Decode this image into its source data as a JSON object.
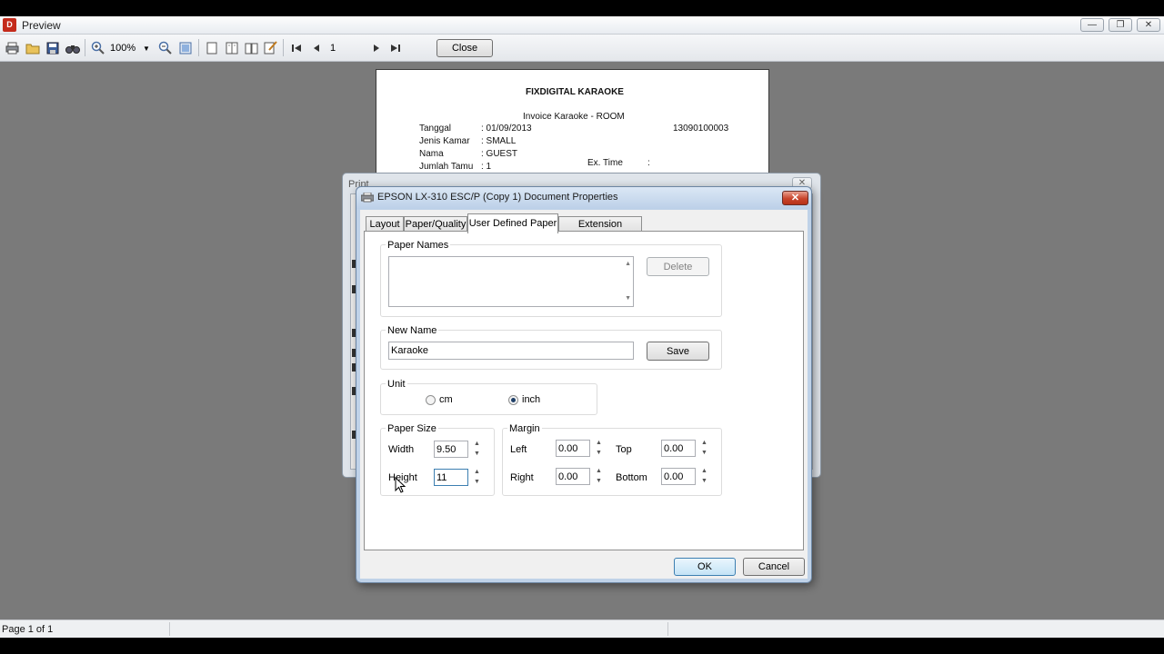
{
  "window": {
    "title": "Preview",
    "app_icon_glyph": "D"
  },
  "toolbar": {
    "zoom": "100%",
    "page_number": "1",
    "close_label": "Close",
    "icons": [
      "printer-icon",
      "open-icon",
      "save-icon",
      "find-icon",
      "zoom-in-icon",
      "zoom-out-icon",
      "fit-page-icon",
      "single-page-icon",
      "two-page-icon",
      "book-icon",
      "edit-icon",
      "first-page-icon",
      "prev-page-icon",
      "next-page-icon",
      "last-page-icon"
    ]
  },
  "report": {
    "title": "FIXDIGITAL KARAOKE",
    "subtitle": "Invoice Karaoke - ROOM",
    "invoice_no": "13090100003",
    "rows": [
      {
        "label": "Tanggal",
        "value": ": 01/09/2013"
      },
      {
        "label": "Jenis Kamar",
        "value": ": SMALL"
      },
      {
        "label": "Nama",
        "value": ": GUEST"
      },
      {
        "label": "Jumlah Tamu",
        "value": ": 1"
      }
    ],
    "ex_time_label": "Ex. Time",
    "ex_time_value": ":"
  },
  "print_dialog": {
    "title": "Print"
  },
  "props_dialog": {
    "title": "EPSON LX-310 ESC/P (Copy 1) Document Properties",
    "tabs": [
      {
        "label": "Layout"
      },
      {
        "label": "Paper/Quality"
      },
      {
        "label": "User Defined Paper"
      },
      {
        "label": "Extension Settings"
      }
    ],
    "active_tab": "User Defined Paper",
    "paper_names": {
      "label": "Paper Names",
      "delete_label": "Delete"
    },
    "new_name": {
      "label": "New Name",
      "value": "Karaoke",
      "save_label": "Save"
    },
    "unit": {
      "label": "Unit",
      "cm_label": "cm",
      "inch_label": "inch",
      "selected": "inch"
    },
    "paper_size": {
      "label": "Paper Size",
      "width_label": "Width",
      "width_value": "9.50",
      "height_label": "Height",
      "height_value": "11"
    },
    "margin": {
      "label": "Margin",
      "left_label": "Left",
      "left_value": "0.00",
      "top_label": "Top",
      "top_value": "0.00",
      "right_label": "Right",
      "right_value": "0.00",
      "bottom_label": "Bottom",
      "bottom_value": "0.00"
    },
    "ok_label": "OK",
    "cancel_label": "Cancel"
  },
  "status": {
    "page_text": "Page 1 of 1"
  },
  "colors": {
    "workspace": "#7a7a7a",
    "dialog_frame": "#bfd2e8",
    "close_button_red": "#c8442c"
  }
}
